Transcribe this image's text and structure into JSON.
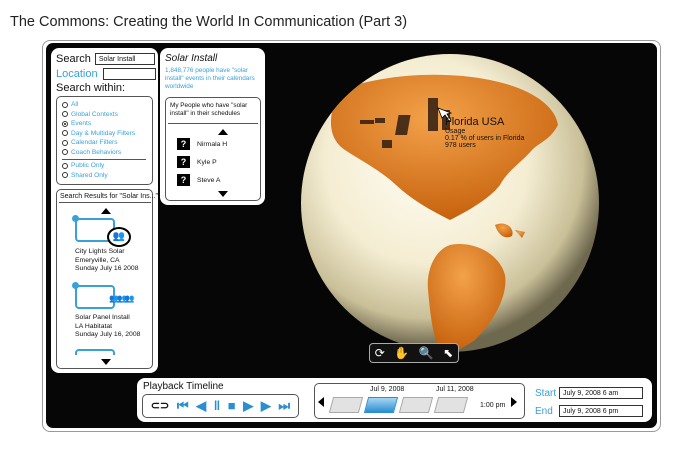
{
  "title": "The Commons: Creating the World In Communication  (Part 3)",
  "search": {
    "label": "Search",
    "value": "Solar Install",
    "location_label": "Location",
    "location_value": "",
    "within_label": "Search within:",
    "options": [
      {
        "label": "All",
        "selected": false
      },
      {
        "label": "Global Contexts",
        "selected": false
      },
      {
        "label": "Events",
        "selected": true
      },
      {
        "label": "Day & Multiday Filters",
        "selected": false
      },
      {
        "label": "Calendar Filters",
        "selected": false
      },
      {
        "label": "Coach Behaviors",
        "selected": false
      }
    ],
    "scope_options": [
      {
        "label": "Public Only",
        "selected": false
      },
      {
        "label": "Shared Only",
        "selected": false
      }
    ]
  },
  "results": {
    "header": "Search Results for \"Solar Ins...\"",
    "items": [
      {
        "line1": "City Lights Solar",
        "line2": "Emeryville, CA",
        "line3": "Sunday July 16 2008"
      },
      {
        "line1": "Solar Panel Install",
        "line2": "LA Habitatat",
        "line3": "Sunday July 16, 2008"
      }
    ]
  },
  "detail": {
    "title": "Solar Install",
    "summary": "1,848,776 people have \"solar install\" events in their calendars worldwide",
    "people_header": "My People who have \"solar install\" in their schedules",
    "people": [
      {
        "icon": "?",
        "name": "Nirmala H"
      },
      {
        "icon": "?",
        "name": "Kyle P"
      },
      {
        "icon": "?",
        "name": "Steve A"
      }
    ]
  },
  "globe": {
    "tooltip_title": "Florida USA",
    "tooltip_line1": "Usage",
    "tooltip_line2": "0.17 % of users in Florida",
    "tooltip_line3": "978 users",
    "tools": [
      "rotate-icon",
      "hand-icon",
      "zoom-icon",
      "select-icon"
    ]
  },
  "timeline": {
    "title": "Playback Timeline",
    "date1": "Jul 9, 2008",
    "date2": "Jul 11, 2008",
    "time": "1:00 pm",
    "start_label": "Start",
    "start_value": "July 9, 2008 6 am",
    "end_label": "End",
    "end_value": "July 9, 2008 6 pm"
  },
  "colors": {
    "accent": "#3aa0d8",
    "globe_orange": "#e07a1a",
    "background": "#060606"
  }
}
